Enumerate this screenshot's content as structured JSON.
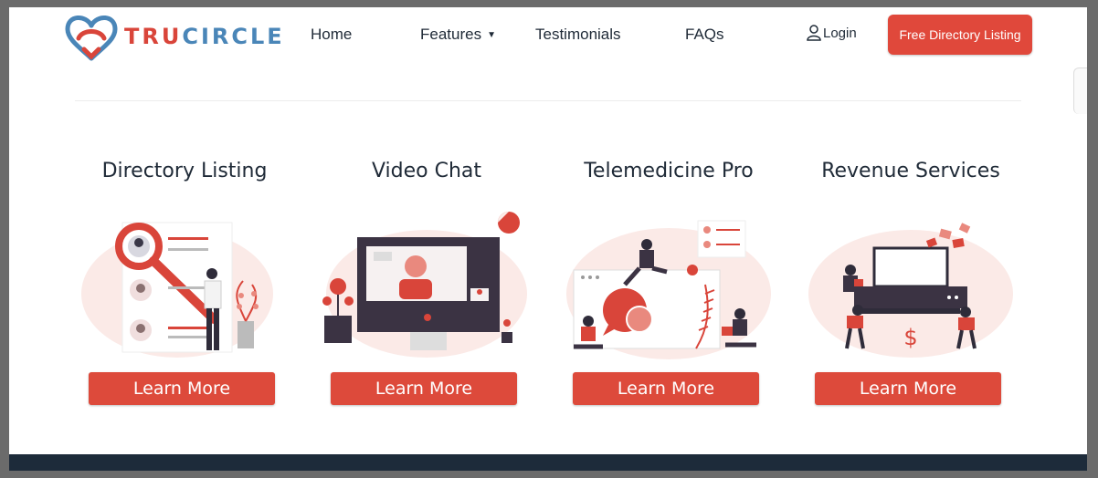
{
  "brand": {
    "name_part1": "TRU",
    "name_part2": "CIRCLE",
    "accent": "#e0483b",
    "secondary": "#4a86b8"
  },
  "nav": {
    "home": "Home",
    "features": "Features",
    "testimonials": "Testimonials",
    "faqs": "FAQs",
    "login": "Login",
    "cta": "Free Directory Listing"
  },
  "services": [
    {
      "title": "Directory Listing",
      "button": "Learn More",
      "illustration": "directory-illustration"
    },
    {
      "title": "Video Chat",
      "button": "Learn More",
      "illustration": "video-chat-illustration"
    },
    {
      "title": "Telemedicine Pro",
      "button": "Learn More",
      "illustration": "telemedicine-illustration"
    },
    {
      "title": "Revenue Services",
      "button": "Learn More",
      "illustration": "revenue-illustration"
    }
  ],
  "icons": {
    "features_dropdown": "chevron-down-icon",
    "login": "user-icon"
  }
}
